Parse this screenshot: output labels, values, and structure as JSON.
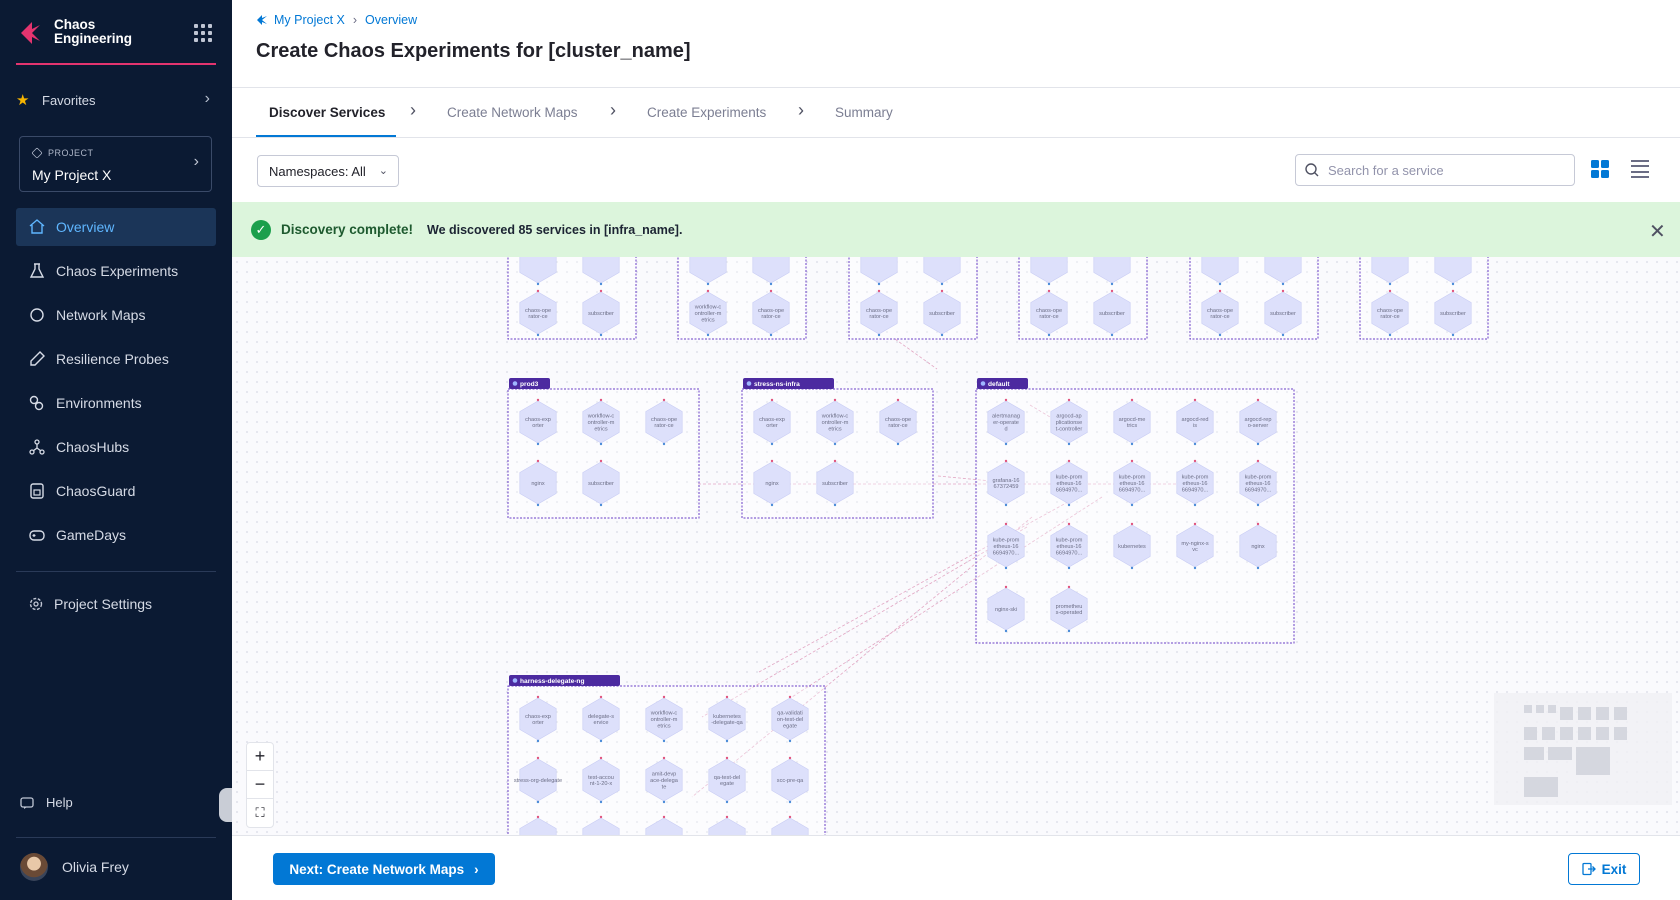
{
  "sidebar": {
    "brand_line1": "Chaos",
    "brand_line2": "Engineering",
    "favorites_label": "Favorites",
    "project_caption": "PROJECT",
    "project_name": "My Project X",
    "nav": [
      {
        "label": "Overview",
        "icon": "home-icon",
        "active": true
      },
      {
        "label": "Chaos Experiments",
        "icon": "flask-icon"
      },
      {
        "label": "Network Maps",
        "icon": "circle-icon"
      },
      {
        "label": "Resilience Probes",
        "icon": "probe-icon"
      },
      {
        "label": "Environments",
        "icon": "environments-icon"
      },
      {
        "label": "ChaosHubs",
        "icon": "hub-icon"
      },
      {
        "label": "ChaosGuard",
        "icon": "guard-icon"
      },
      {
        "label": "GameDays",
        "icon": "gamepad-icon"
      }
    ],
    "settings_label": "Project Settings",
    "help_label": "Help",
    "user_name": "Olivia Frey"
  },
  "header": {
    "breadcrumb": [
      "My Project X",
      "Overview"
    ],
    "title": "Create Chaos Experiments for [cluster_name]"
  },
  "steps": [
    "Discover Services",
    "Create Network Maps",
    "Create Experiments",
    "Summary"
  ],
  "toolbar": {
    "namespace_label": "Namespaces: All",
    "search_placeholder": "Search for a service"
  },
  "banner": {
    "title": "Discovery complete!",
    "message": "We discovered 85 services in [infra_name]."
  },
  "graph": {
    "colors": {
      "group_border": "#6a3fc7",
      "tag_bg": "#4c2aa0",
      "node_fill": "#dde0fb",
      "node_text": "#6b6d85",
      "edge": "#e2a6c3"
    },
    "top_groups": [
      [
        "chaos-ope rator-ce",
        "subscriber"
      ],
      [
        "workflow-c ontroller-m etrics",
        "chaos-ope rator-ce"
      ],
      [
        "chaos-ope rator-ce",
        "subscriber"
      ],
      [
        "chaos-ope rator-ce",
        "subscriber"
      ],
      [
        "chaos-ope rator-ce",
        "subscriber"
      ],
      [
        "chaos-ope rator-ce",
        "subscriber"
      ]
    ],
    "groups": [
      {
        "name": "prod3",
        "nodes": [
          "chaos-exp orter",
          "workflow-c ontroller-m etrics",
          "chaos-ope rator-ce",
          "nginx",
          "subscriber"
        ]
      },
      {
        "name": "stress-ns-infra",
        "nodes": [
          "chaos-exp orter",
          "workflow-c ontroller-m etrics",
          "chaos-ope rator-ce",
          "nginx",
          "subscriber"
        ]
      },
      {
        "name": "default",
        "nodes": [
          "alertmanag er-operate d",
          "argocd-ap plicationse t-controller",
          "argocd-me trics",
          "argocd-red is",
          "argocd-rep o-server",
          "grafana-16 67372459",
          "kube-prom etheus-16 6694970...",
          "kube-prom etheus-16 6694970...",
          "kube-prom etheus-16 6694970...",
          "kube-prom etheus-16 6694970...",
          "kube-prom etheus-16 6694970...",
          "kube-prom etheus-16 6694970...",
          "kubernetes",
          "my-nginx-s vc",
          "nginx",
          "nginx-ski",
          "prometheu s-operated"
        ]
      },
      {
        "name": "harness-delegate-ng",
        "nodes": [
          "chaos-exp orter",
          "delegate-s ervice",
          "workflow-c ontroller-m etrics",
          "kubernetes -delegate-qa",
          "qa-validati on-test-del egate",
          "stress-org-delegate",
          "test-accou nt-1-20-x",
          "amit-devp ace-delega te",
          "qa-test-del egate",
          "scc-pre-qa"
        ]
      }
    ]
  },
  "footer": {
    "next_label": "Next: Create Network Maps",
    "exit_label": "Exit"
  }
}
